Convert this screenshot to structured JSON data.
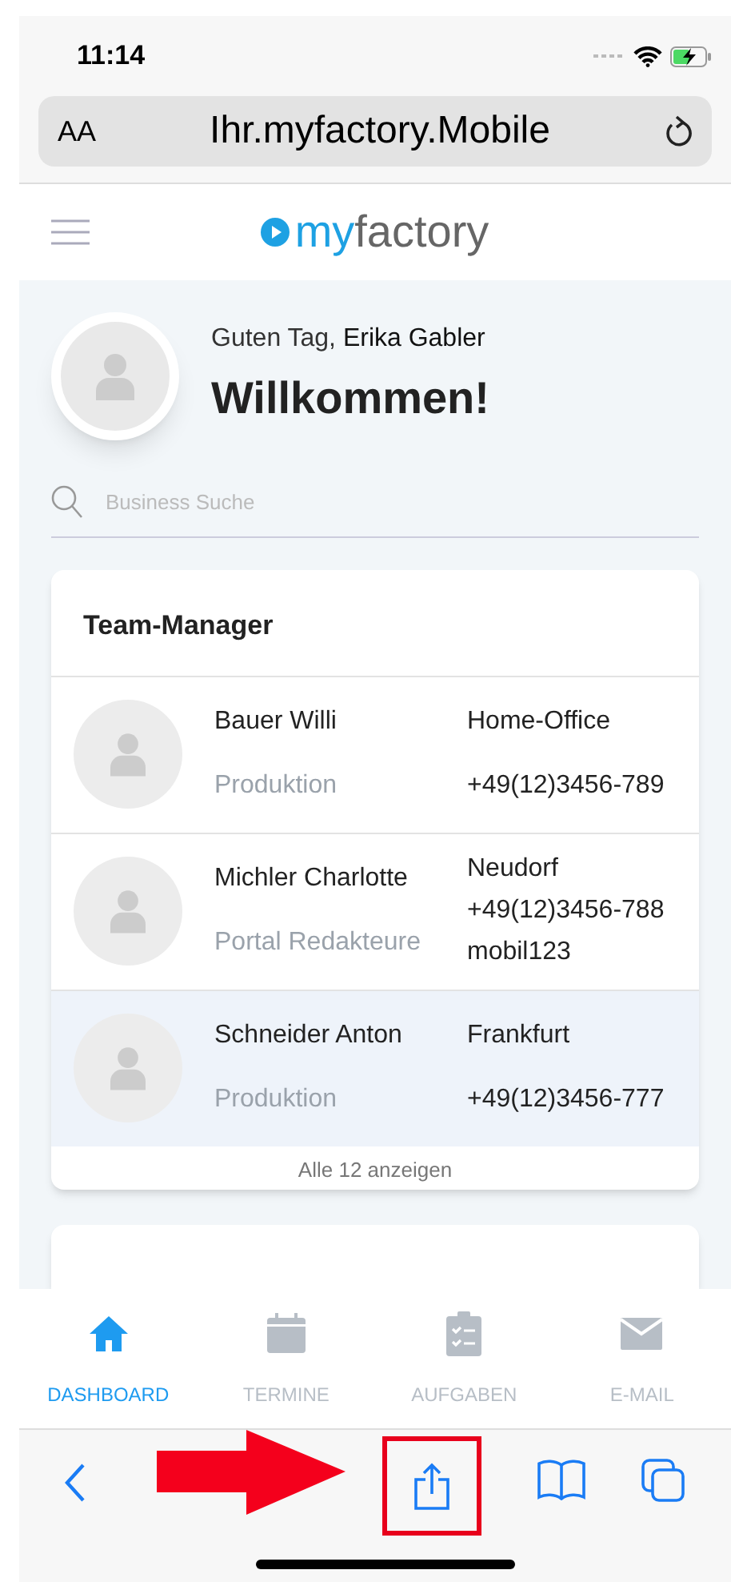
{
  "status_bar": {
    "time": "11:14"
  },
  "address_bar": {
    "text_size": "AA",
    "url": "Ihr.myfactory.Mobile"
  },
  "app_header": {
    "logo_prefix": "my",
    "logo_suffix": "factory"
  },
  "greeting": {
    "salutation": "Guten Tag, ",
    "user_name": "Erika Gabler",
    "title": "Willkommen!"
  },
  "search": {
    "placeholder": "Business Suche"
  },
  "team_card": {
    "title": "Team-Manager",
    "show_all": "Alle 12 anzeigen",
    "members": [
      {
        "name": "Bauer Willi",
        "department": "Produktion",
        "contact": [
          "Home-Office",
          "+49(12)3456-789"
        ],
        "selected": false
      },
      {
        "name": "Michler Charlotte",
        "department": "Portal Redakteure",
        "contact": [
          "Neudorf",
          "+49(12)3456-788",
          "mobil123"
        ],
        "selected": false
      },
      {
        "name": "Schneider Anton",
        "department": "Produktion",
        "contact": [
          "Frankfurt",
          "+49(12)3456-777"
        ],
        "selected": true
      }
    ]
  },
  "tab_bar": [
    {
      "label": "DASHBOARD",
      "kind": "home",
      "selected": true
    },
    {
      "label": "TERMINE",
      "kind": "calendar",
      "selected": false
    },
    {
      "label": "AUFGABEN",
      "kind": "tasks",
      "selected": false
    },
    {
      "label": "E-MAIL",
      "kind": "mail",
      "selected": false
    }
  ],
  "browser_toolbar": {
    "share_highlighted": true
  }
}
